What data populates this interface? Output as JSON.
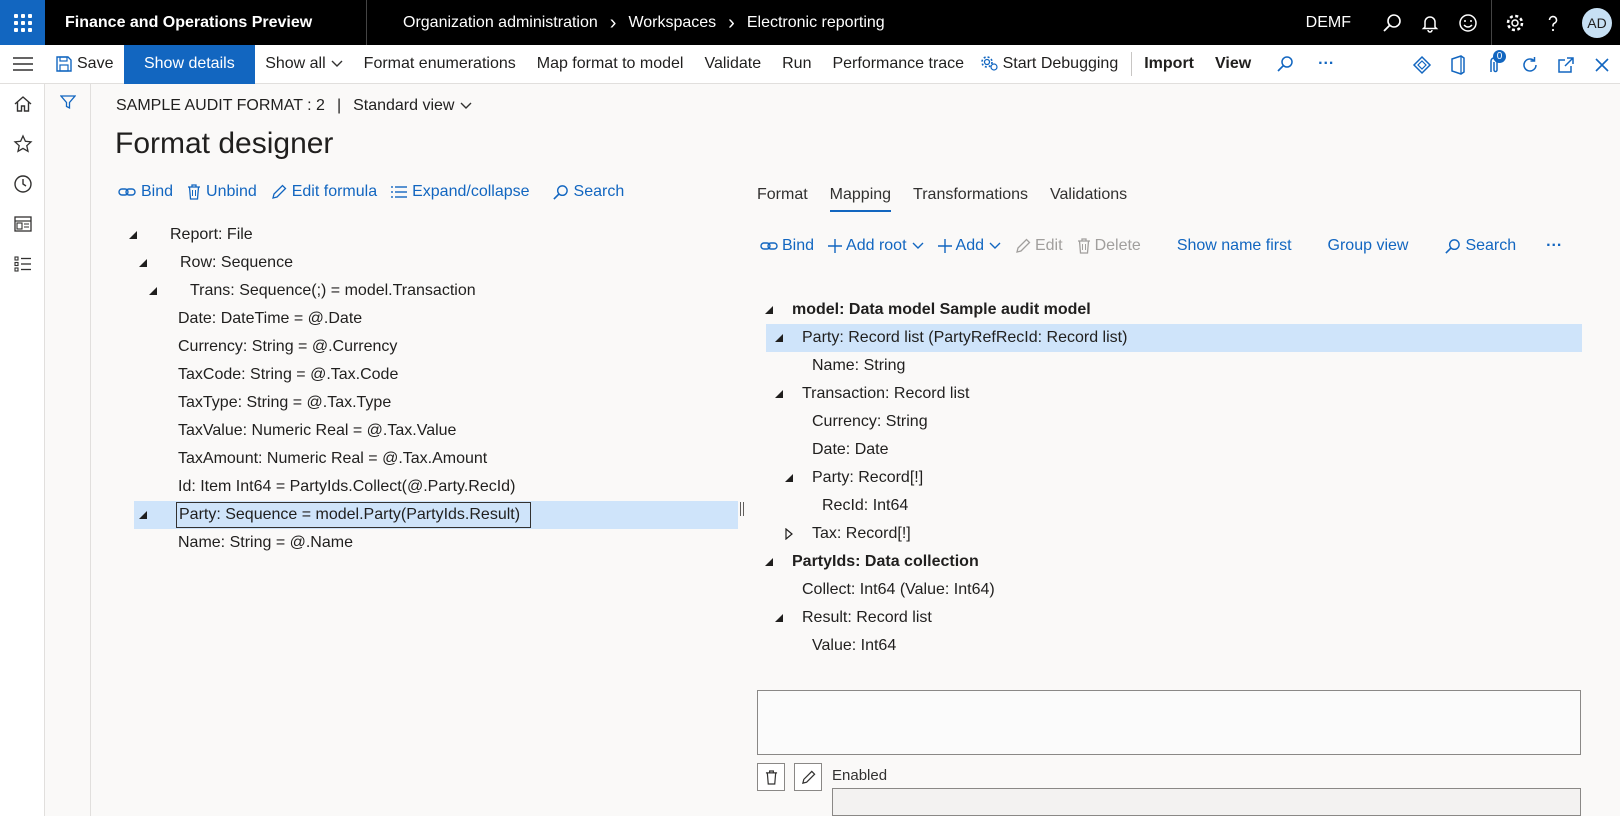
{
  "topbar": {
    "app_title": "Finance and Operations Preview",
    "breadcrumbs": [
      "Organization administration",
      "Workspaces",
      "Electronic reporting"
    ],
    "company": "DEMF",
    "avatar_initials": "AD"
  },
  "actions": {
    "save": "Save",
    "show_details": "Show details",
    "show_all": "Show all",
    "format_enumerations": "Format enumerations",
    "map_format_to_model": "Map format to model",
    "validate": "Validate",
    "run": "Run",
    "performance_trace": "Performance trace",
    "start_debugging": "Start Debugging",
    "import": "Import",
    "view": "View",
    "more": "···",
    "attachments_count": "0"
  },
  "header": {
    "record": "SAMPLE AUDIT FORMAT : 2",
    "separator": "|",
    "view_name": "Standard view",
    "title": "Format designer"
  },
  "format_toolbar": {
    "bind": "Bind",
    "unbind": "Unbind",
    "edit_formula": "Edit formula",
    "expand_collapse": "Expand/collapse",
    "search": "Search"
  },
  "format_tree": [
    {
      "label": "Report: File",
      "level": 0,
      "expander": "expanded"
    },
    {
      "label": "Row: Sequence",
      "level": 1,
      "expander": "expanded"
    },
    {
      "label": "Trans: Sequence(;) = model.Transaction",
      "level": 2,
      "expander": "expanded"
    },
    {
      "label": "Date: DateTime = @.Date",
      "level": 3,
      "expander": "none"
    },
    {
      "label": "Currency: String = @.Currency",
      "level": 3,
      "expander": "none"
    },
    {
      "label": "TaxCode: String = @.Tax.Code",
      "level": 3,
      "expander": "none"
    },
    {
      "label": "TaxType: String = @.Tax.Type",
      "level": 3,
      "expander": "none"
    },
    {
      "label": "TaxValue: Numeric Real = @.Tax.Value",
      "level": 3,
      "expander": "none"
    },
    {
      "label": "TaxAmount: Numeric Real = @.Tax.Amount",
      "level": 3,
      "expander": "none"
    },
    {
      "label": "Id: Item Int64 = PartyIds.Collect(@.Party.RecId)",
      "level": 3,
      "expander": "none"
    },
    {
      "label": "Party: Sequence = model.Party(PartyIds.Result)",
      "level": 1,
      "expander": "expanded",
      "selected": true
    },
    {
      "label": "Name: String = @.Name",
      "level": 3,
      "expander": "none"
    }
  ],
  "tabs": [
    {
      "label": "Format",
      "active": false
    },
    {
      "label": "Mapping",
      "active": true
    },
    {
      "label": "Transformations",
      "active": false
    },
    {
      "label": "Validations",
      "active": false
    }
  ],
  "mapping_toolbar": {
    "bind": "Bind",
    "add_root": "Add root",
    "add": "Add",
    "edit": "Edit",
    "delete": "Delete",
    "show_name_first": "Show name first",
    "group_view": "Group view",
    "search": "Search",
    "more": "···"
  },
  "mapping_tree": [
    {
      "label": "model: Data model Sample audit model",
      "level": 0,
      "expander": "expanded",
      "bold": true
    },
    {
      "label": "Party: Record list (PartyRefRecId: Record list)",
      "level": 1,
      "expander": "expanded",
      "selected": true
    },
    {
      "label": "Name: String",
      "level": 2,
      "expander": "none"
    },
    {
      "label": "Transaction: Record list",
      "level": 1,
      "expander": "expanded"
    },
    {
      "label": "Currency: String",
      "level": 2,
      "expander": "none"
    },
    {
      "label": "Date: Date",
      "level": 2,
      "expander": "none"
    },
    {
      "label": "Party: Record[!]",
      "level": 2,
      "expander": "expanded"
    },
    {
      "label": "RecId: Int64",
      "level": 3,
      "expander": "none"
    },
    {
      "label": "Tax: Record[!]",
      "level": 2,
      "expander": "collapsed"
    },
    {
      "label": "PartyIds: Data collection",
      "level": 0,
      "expander": "expanded",
      "bold": true
    },
    {
      "label": "Collect: Int64 (Value: Int64)",
      "level": 1,
      "expander": "none"
    },
    {
      "label": "Result: Record list",
      "level": 1,
      "expander": "expanded"
    },
    {
      "label": "Value: Int64",
      "level": 2,
      "expander": "none"
    }
  ],
  "details": {
    "enabled_label": "Enabled",
    "enabled_value": ""
  },
  "colors": {
    "accent": "#1266c0",
    "selection": "#cfe4fa",
    "topbar": "#000000"
  }
}
